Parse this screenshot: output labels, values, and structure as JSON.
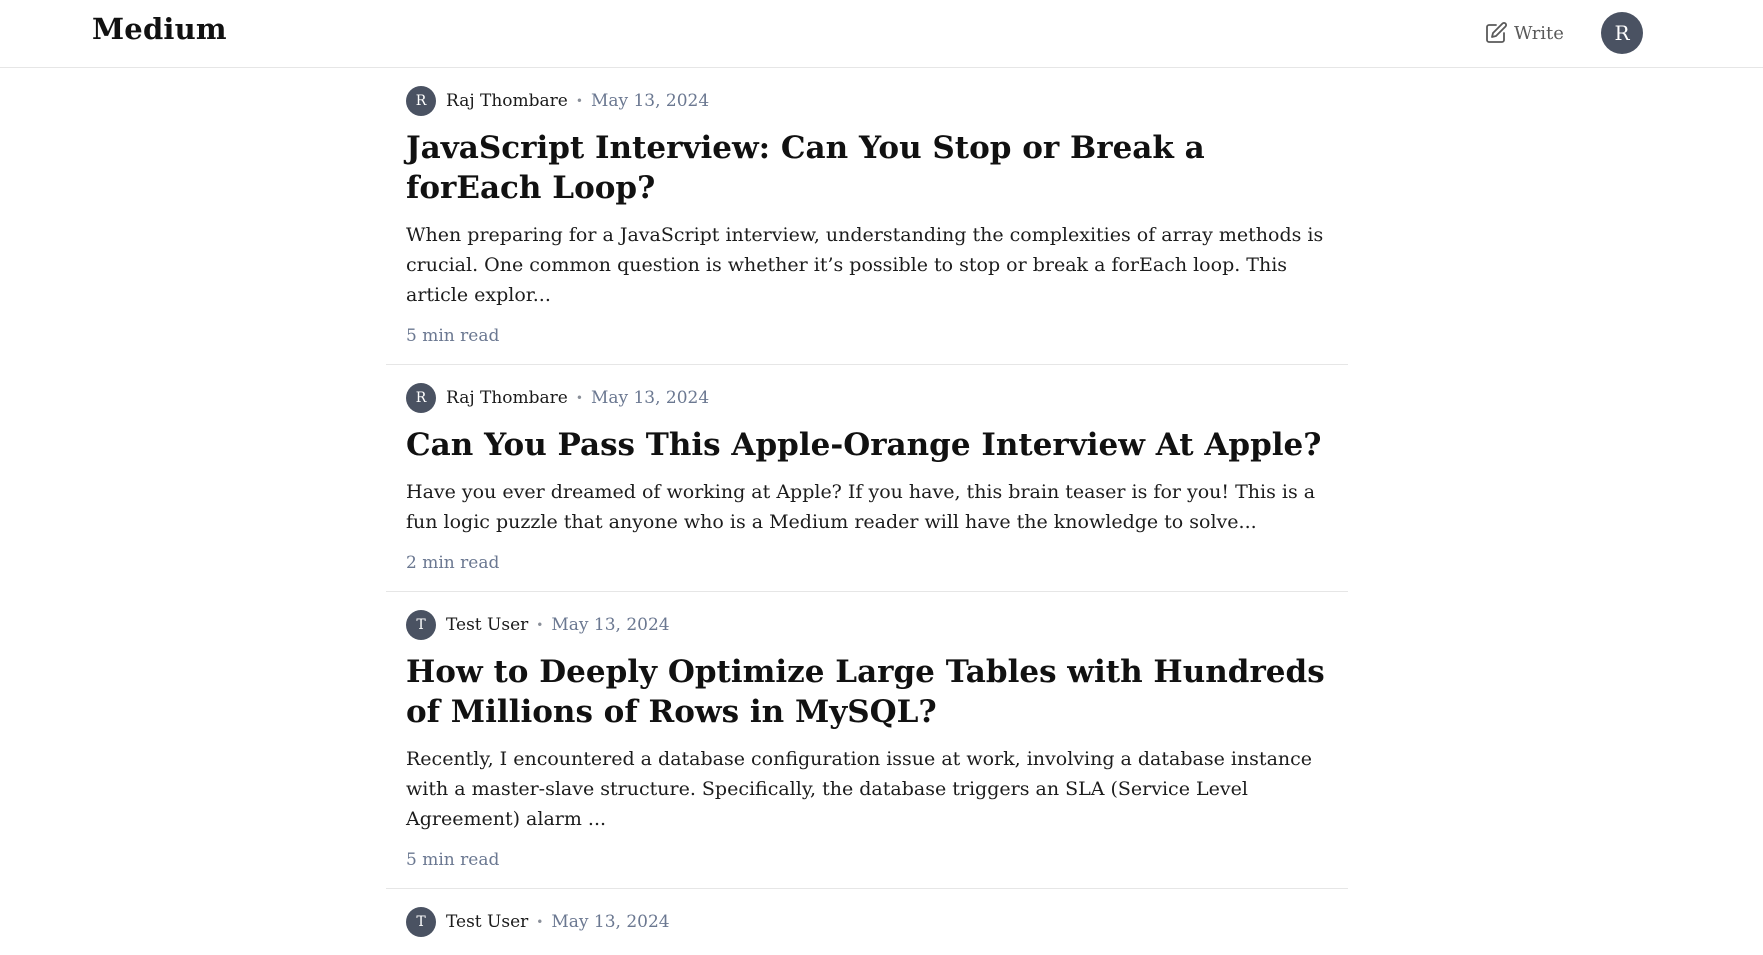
{
  "header": {
    "brand": "Medium",
    "write_label": "Write",
    "avatar_initial": "R",
    "icon": "write-icon"
  },
  "posts": [
    {
      "avatar_initial": "R",
      "author": "Raj Thombare",
      "date": "May 13, 2024",
      "title": "JavaScript Interview: Can You Stop or Break a forEach Loop?",
      "excerpt": "When preparing for a JavaScript interview, understanding the complexities of array methods is crucial. One common question is whether it’s possible to stop or break a forEach loop. This article explor...",
      "read_time": "5 min read"
    },
    {
      "avatar_initial": "R",
      "author": "Raj Thombare",
      "date": "May 13, 2024",
      "title": "Can You Pass This Apple-Orange Interview At Apple?",
      "excerpt": "Have you ever dreamed of working at Apple? If you have, this brain teaser is for you! This is a fun logic puzzle that anyone who is a Medium reader will have the knowledge to solve...",
      "read_time": "2 min read"
    },
    {
      "avatar_initial": "T",
      "author": "Test User",
      "date": "May 13, 2024",
      "title": "How to Deeply Optimize Large Tables with Hundreds of Millions of Rows in MySQL?",
      "excerpt": "Recently, I encountered a database configuration issue at work, involving a database instance with a master-slave structure. Specifically, the database triggers an SLA (Service Level Agreement) alarm ...",
      "read_time": "5 min read"
    },
    {
      "avatar_initial": "T",
      "author": "Test User",
      "date": "May 13, 2024"
    }
  ],
  "colors": {
    "avatar_bg": "#4a5262",
    "muted_text": "#6b7891",
    "divider": "#e6e6e6"
  }
}
